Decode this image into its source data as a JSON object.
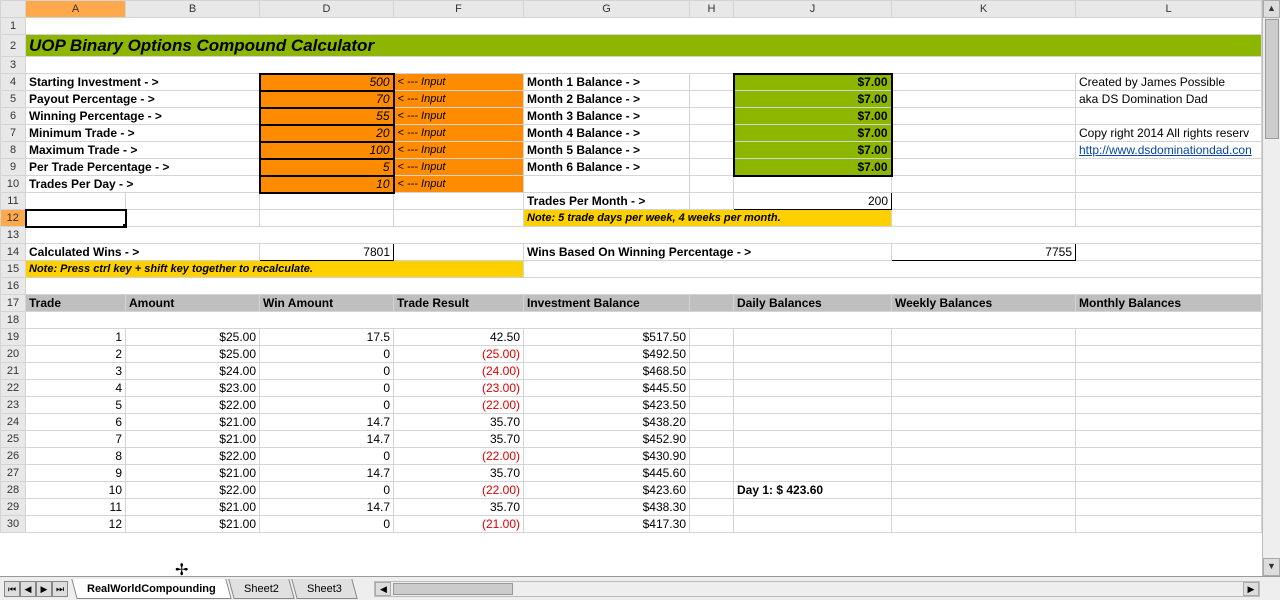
{
  "columns": [
    "",
    "A",
    "B",
    "D",
    "F",
    "G",
    "H",
    "J",
    "K",
    "L"
  ],
  "title": "UOP Binary Options Compound Calculator",
  "inputs": [
    {
      "label": "Starting Investment - >",
      "value": "500",
      "hint": "< --- Input"
    },
    {
      "label": "Payout Percentage - >",
      "value": "70",
      "hint": "< --- Input"
    },
    {
      "label": "Winning Percentage - >",
      "value": "55",
      "hint": "< --- Input"
    },
    {
      "label": "Minimum Trade - >",
      "value": "20",
      "hint": "< --- Input"
    },
    {
      "label": "Maximum Trade - >",
      "value": "100",
      "hint": "< --- Input"
    },
    {
      "label": "Per Trade Percentage - >",
      "value": "5",
      "hint": "< --- Input"
    },
    {
      "label": "Trades Per Day - >",
      "value": "10",
      "hint": "< --- Input"
    }
  ],
  "balances": [
    {
      "label": "Month 1 Balance - >",
      "value": "$7.00"
    },
    {
      "label": "Month 2 Balance - >",
      "value": "$7.00"
    },
    {
      "label": "Month 3 Balance - >",
      "value": "$7.00"
    },
    {
      "label": "Month 4 Balance - >",
      "value": "$7.00"
    },
    {
      "label": "Month 5 Balance - >",
      "value": "$7.00"
    },
    {
      "label": "Month 6 Balance - >",
      "value": "$7.00"
    }
  ],
  "credits": {
    "line1": "Created by James Possible",
    "line2": "aka DS Domination Dad",
    "copyright": "Copy right 2014 All rights reserv",
    "url": "http://www.dsdominationdad.con"
  },
  "trades_per_month": {
    "label": "Trades Per Month - >",
    "value": "200"
  },
  "note1": "Note: 5 trade days per week, 4 weeks per month.",
  "calc_wins": {
    "label": "Calculated Wins - >",
    "value": "7801"
  },
  "wins_pct": {
    "label": "Wins Based On Winning Percentage - >",
    "value": "7755"
  },
  "note2": "Note: Press ctrl key + shift key together to recalculate.",
  "table_headers": [
    "Trade",
    "Amount",
    "Win Amount",
    "Trade Result",
    "Investment Balance",
    "Daily Balances",
    "Weekly Balances",
    "Monthly Balances"
  ],
  "rows": [
    {
      "n": 19,
      "t": "1",
      "amt": "$25.00",
      "win": "17.5",
      "res": "42.50",
      "res_neg": false,
      "bal": "$517.50",
      "daily": ""
    },
    {
      "n": 20,
      "t": "2",
      "amt": "$25.00",
      "win": "0",
      "res": "(25.00)",
      "res_neg": true,
      "bal": "$492.50",
      "daily": ""
    },
    {
      "n": 21,
      "t": "3",
      "amt": "$24.00",
      "win": "0",
      "res": "(24.00)",
      "res_neg": true,
      "bal": "$468.50",
      "daily": ""
    },
    {
      "n": 22,
      "t": "4",
      "amt": "$23.00",
      "win": "0",
      "res": "(23.00)",
      "res_neg": true,
      "bal": "$445.50",
      "daily": ""
    },
    {
      "n": 23,
      "t": "5",
      "amt": "$22.00",
      "win": "0",
      "res": "(22.00)",
      "res_neg": true,
      "bal": "$423.50",
      "daily": ""
    },
    {
      "n": 24,
      "t": "6",
      "amt": "$21.00",
      "win": "14.7",
      "res": "35.70",
      "res_neg": false,
      "bal": "$438.20",
      "daily": ""
    },
    {
      "n": 25,
      "t": "7",
      "amt": "$21.00",
      "win": "14.7",
      "res": "35.70",
      "res_neg": false,
      "bal": "$452.90",
      "daily": ""
    },
    {
      "n": 26,
      "t": "8",
      "amt": "$22.00",
      "win": "0",
      "res": "(22.00)",
      "res_neg": true,
      "bal": "$430.90",
      "daily": ""
    },
    {
      "n": 27,
      "t": "9",
      "amt": "$21.00",
      "win": "14.7",
      "res": "35.70",
      "res_neg": false,
      "bal": "$445.60",
      "daily": ""
    },
    {
      "n": 28,
      "t": "10",
      "amt": "$22.00",
      "win": "0",
      "res": "(22.00)",
      "res_neg": true,
      "bal": "$423.60",
      "daily": "Day 1: $ 423.60"
    },
    {
      "n": 29,
      "t": "11",
      "amt": "$21.00",
      "win": "14.7",
      "res": "35.70",
      "res_neg": false,
      "bal": "$438.30",
      "daily": ""
    },
    {
      "n": 30,
      "t": "12",
      "amt": "$21.00",
      "win": "0",
      "res": "(21.00)",
      "res_neg": true,
      "bal": "$417.30",
      "daily": ""
    }
  ],
  "tabs": [
    "RealWorldCompounding",
    "Sheet2",
    "Sheet3"
  ],
  "active_tab": 0
}
